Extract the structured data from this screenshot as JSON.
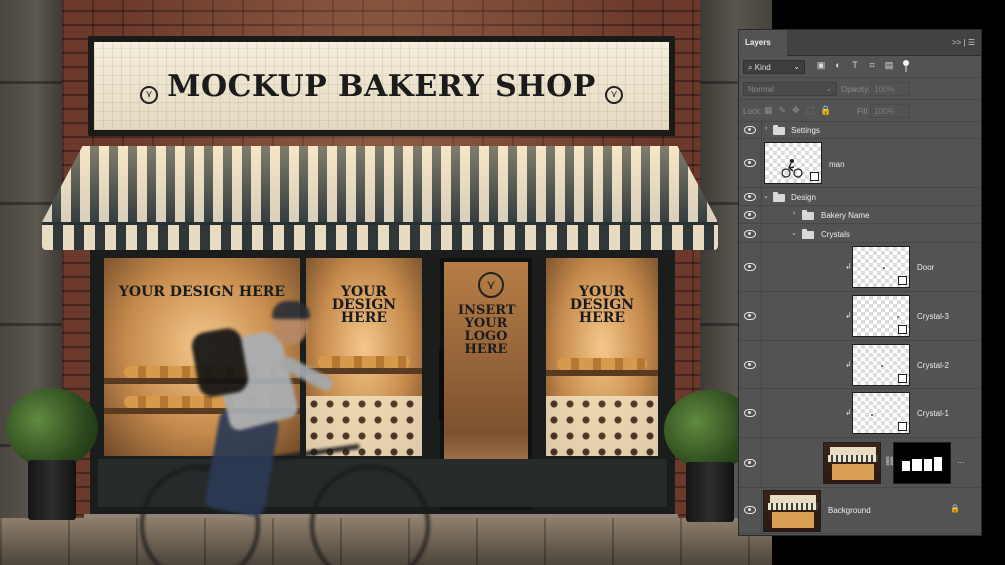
{
  "scene": {
    "sign_title": "MOCKUP BAKERY SHOP",
    "window_left_text": "YOUR DESIGN HERE",
    "window_mid_text": "YOUR DESIGN HERE",
    "door_text": "INSERT YOUR LOGO HERE",
    "window_right_text": "YOUR DESIGN HERE"
  },
  "panel": {
    "tab_label": "Layers",
    "tab_icons": ">> | ☰",
    "filter": {
      "kind_label": "Kind",
      "icons": [
        "image-filter-icon",
        "adjustment-filter-icon",
        "type-filter-icon",
        "shape-filter-icon",
        "smart-object-filter-icon"
      ],
      "icon_glyphs": [
        "▣",
        "◐",
        "T",
        "⌗",
        "▤"
      ]
    },
    "blend_mode": "Normal",
    "opacity_label": "Opacity:",
    "opacity_value": "100%",
    "lock_label": "Lock:",
    "lock_glyphs": [
      "▦",
      "✎",
      "✥",
      "⬚",
      "🔒"
    ],
    "fill_label": "Fill:",
    "fill_value": "100%"
  },
  "layers": [
    {
      "name": "Settings",
      "type": "group",
      "indent": 0,
      "expanded": false
    },
    {
      "name": "man",
      "type": "smart-object",
      "indent": 0
    },
    {
      "name": "Design",
      "type": "group",
      "indent": 0,
      "expanded": true
    },
    {
      "name": "Bakery Name",
      "type": "group",
      "indent": 1,
      "expanded": false
    },
    {
      "name": "Crystals",
      "type": "group",
      "indent": 1,
      "expanded": true
    },
    {
      "name": "Door",
      "type": "smart-object",
      "indent": 2,
      "clipped": true
    },
    {
      "name": "Crystal-3",
      "type": "smart-object",
      "indent": 2,
      "clipped": true
    },
    {
      "name": "Crystal-2",
      "type": "smart-object",
      "indent": 2,
      "clipped": true
    },
    {
      "name": "Crystal-1",
      "type": "smart-object",
      "indent": 2,
      "clipped": true
    },
    {
      "name": "",
      "type": "masked-image",
      "indent": 0
    },
    {
      "name": "Background",
      "type": "background",
      "indent": 0,
      "locked": true
    }
  ]
}
